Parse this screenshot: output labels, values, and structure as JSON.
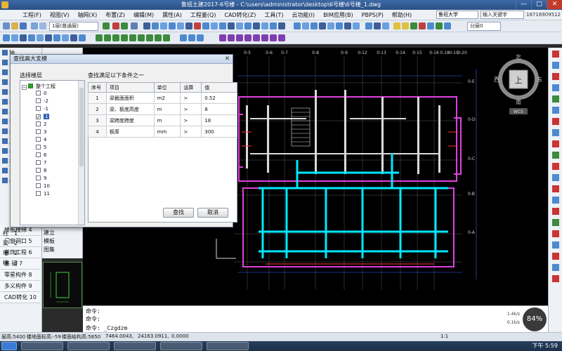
{
  "window": {
    "title": "鲁班土建2017-6号楼 - C:\\users\\administrator\\desktop\\6号楼\\6号楼_1.dwg",
    "min": "—",
    "max": "□",
    "close": "✕"
  },
  "menu": {
    "items": [
      "工程(F)",
      "视图(V)",
      "轴网(X)",
      "布置(Z)",
      "编辑(M)",
      "属性(A)",
      "工程量(Q)",
      "CAD转化(Z)",
      "工具(T)",
      "云功能(I)",
      "BIM应用(B)",
      "PBPS(P)",
      "帮助(H)"
    ],
    "university": "鲁班大学",
    "search_placeholder": "输入关键字",
    "phone": "18716909512"
  },
  "toolbar": {
    "layer_combo": "1层(普通层)",
    "floor_combo": "分层0"
  },
  "left_panel": {
    "tabs": [
      "轴",
      "建",
      "墙",
      "梁",
      "板",
      "柱",
      "基",
      "零",
      "装",
      "屋",
      "楼",
      "构",
      "其",
      "门"
    ],
    "categories": [
      "楼板楼梯 4",
      "门窗洞口 5",
      "装饰工程 6",
      "基    础 7",
      "零星构件 8",
      "多义构件 9",
      "CAD转化 10"
    ]
  },
  "prop_panel": {
    "rows": [
      "柱",
      "梁",
      "墙",
      "楼",
      "建立",
      "模板",
      "图集"
    ],
    "values": [
      "1",
      "2",
      "2",
      "3",
      "",
      "",
      ""
    ]
  },
  "dialog": {
    "title": "查找高大支模",
    "close": "✕",
    "select_label": "选择楼层",
    "cond_label": "查找满足以下条件之一",
    "tree_root": "整个工程",
    "floors": [
      "0",
      "-2",
      "-1",
      "1",
      "2",
      "3",
      "4",
      "5",
      "6",
      "7",
      "8",
      "9",
      "10",
      "11"
    ],
    "checked": [
      "1"
    ],
    "table_headers": [
      "序号",
      "项目",
      "单位",
      "运算",
      "值"
    ],
    "rows": [
      {
        "no": "1",
        "item": "梁截面面积",
        "unit": "m2",
        "op": ">",
        "val": "0.52"
      },
      {
        "no": "2",
        "item": "梁、板底高度",
        "unit": "m",
        "op": ">",
        "val": "8"
      },
      {
        "no": "3",
        "item": "梁跨度跨度",
        "unit": "m",
        "op": ">",
        "val": "18"
      },
      {
        "no": "4",
        "item": "板厚",
        "unit": "mm",
        "op": ">",
        "val": "300"
      }
    ],
    "find_button": "查找",
    "cancel_button": "取消"
  },
  "compass": {
    "north": "北",
    "south": "南",
    "east": "东",
    "west": "西",
    "center": "上",
    "wcs": "WCS"
  },
  "command": {
    "lines": [
      "命令:",
      "命令:",
      "命令: _Czgdzm"
    ]
  },
  "status": {
    "items": [
      "层高:5400",
      "楼地面标高:-59",
      "楼面结构高:5850",
      "7464.0043,",
      "24163.0911,",
      "0.0000"
    ],
    "zoom": "1:1",
    "percent": "84%",
    "speed1": "1.4k/s",
    "speed2": "0.1k/s"
  },
  "taskbar": {
    "clock": "下午 5:59"
  },
  "grid_labels": {
    "top": [
      "0-5",
      "0-6",
      "0-7",
      "0-8",
      "0-9",
      "0-12",
      "0-13",
      "0-14",
      "0-15",
      "0-16",
      "0-18",
      "0-19",
      "0-20"
    ],
    "right": [
      "0-E",
      "0-D",
      "0-C",
      "0-B",
      "0-A"
    ]
  }
}
